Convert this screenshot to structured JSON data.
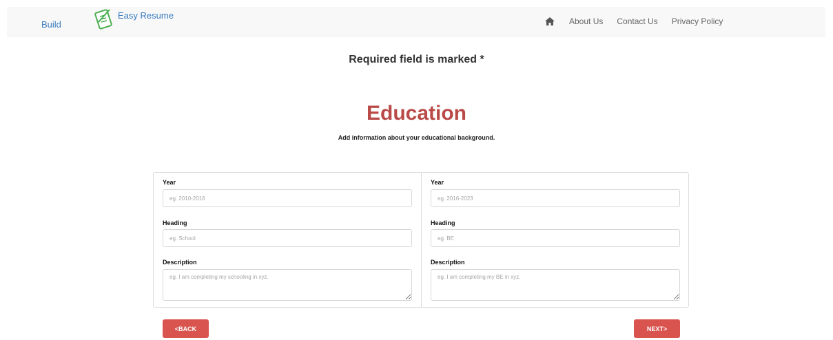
{
  "nav": {
    "build": "Build",
    "brand": "Easy Resume",
    "home_icon": "home-icon",
    "about": "About Us",
    "contact": "Contact Us",
    "privacy": "Privacy Policy"
  },
  "required_note": "Required field is marked *",
  "section": {
    "title": "Education",
    "subtitle": "Add information about your educational background."
  },
  "entries": [
    {
      "year_label": "Year",
      "year_placeholder": "eg. 2010-2016",
      "heading_label": "Heading",
      "heading_placeholder": "eg. School",
      "description_label": "Description",
      "description_placeholder": "eg. I am completing my schooling in xyz."
    },
    {
      "year_label": "Year",
      "year_placeholder": "eg. 2016-2023",
      "heading_label": "Heading",
      "heading_placeholder": "eg. BE",
      "description_label": "Description",
      "description_placeholder": "eg. I am completing my BE in xyz."
    }
  ],
  "buttons": {
    "back": "<BACK",
    "next": "NEXT>"
  },
  "colors": {
    "accent": "#b94a48",
    "button": "#d9534f",
    "link": "#3a7bbf"
  }
}
